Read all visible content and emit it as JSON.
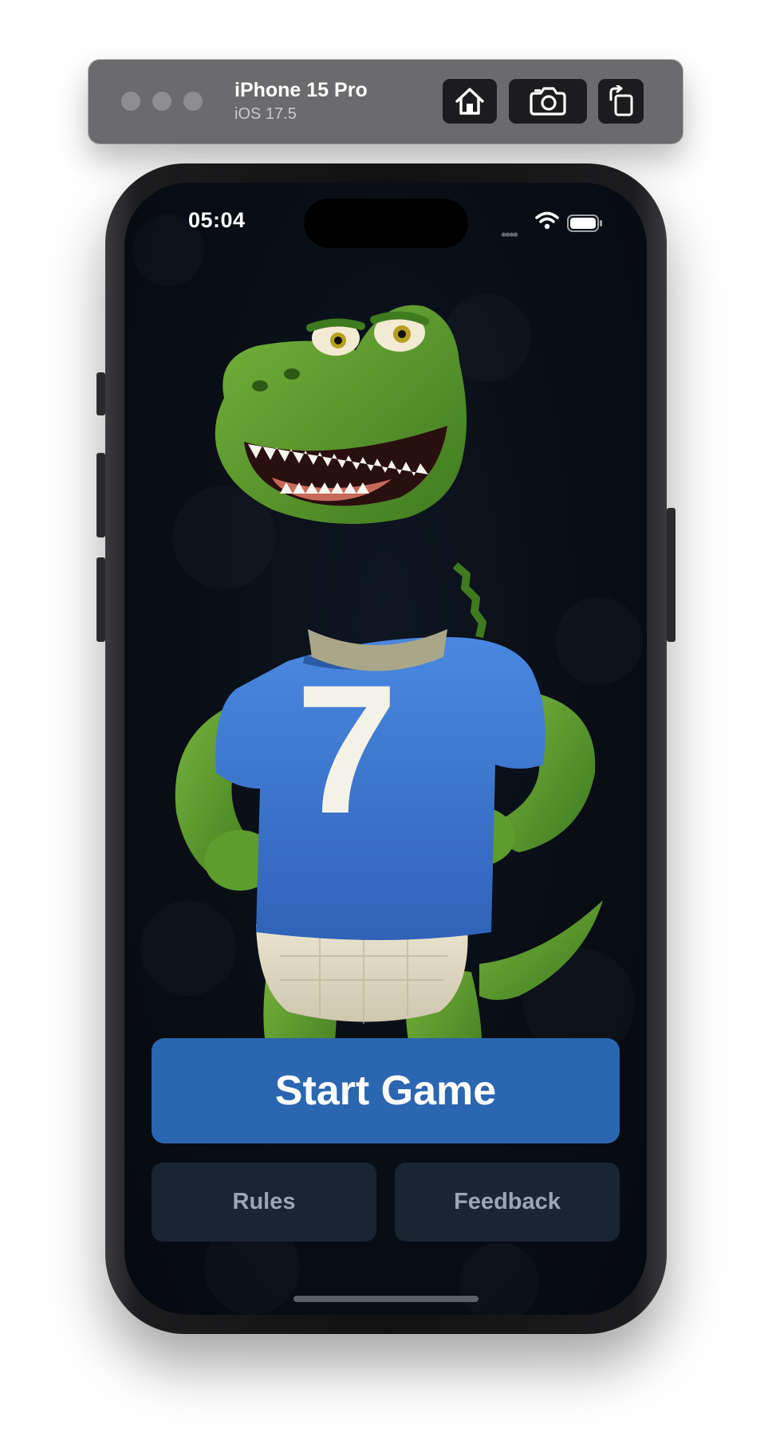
{
  "simulator": {
    "device_name": "iPhone 15 Pro",
    "os_version": "iOS 17.5",
    "buttons": {
      "home_icon": "home-icon",
      "screenshot_icon": "camera-icon",
      "rotate_icon": "rotate-icon"
    }
  },
  "status_bar": {
    "time": "05:04",
    "wifi_icon": "wifi-icon",
    "battery_icon": "battery-icon"
  },
  "hero": {
    "mascot": "crocodile mascot",
    "jersey_number": "7"
  },
  "actions": {
    "start_label": "Start Game",
    "rules_label": "Rules",
    "feedback_label": "Feedback"
  },
  "colors": {
    "primary": "#2b66b0",
    "secondary_bg": "#1a2533",
    "screen_bg": "#090e15",
    "jersey": "#3a78d4",
    "croc_green": "#5e9c2e"
  }
}
